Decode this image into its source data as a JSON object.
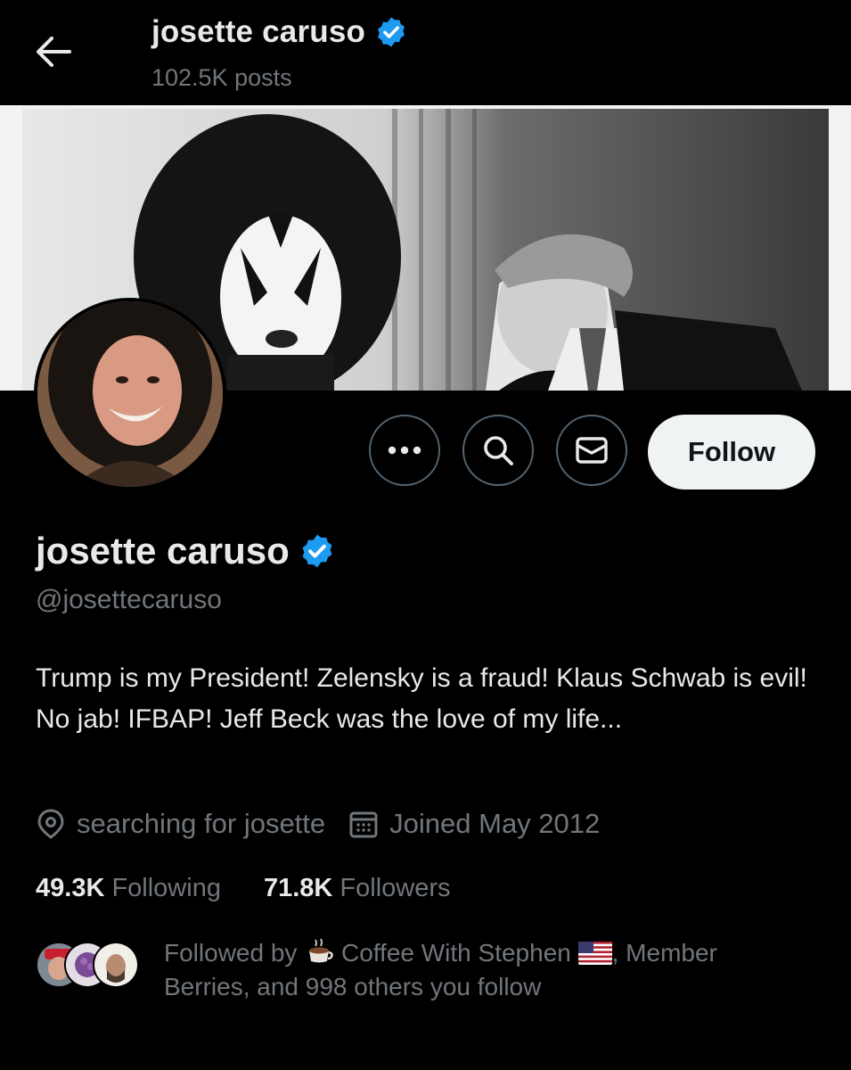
{
  "header": {
    "title": "josette caruso",
    "posts": "102.5K posts"
  },
  "profile": {
    "display_name": "josette caruso",
    "handle": "@josettecaruso",
    "bio": "Trump is my President! Zelensky is a fraud! Klaus Schwab is evil! No jab! IFBAP! Jeff Beck was the love of my life...",
    "location": "searching for josette",
    "joined": "Joined May 2012",
    "following_count": "49.3K",
    "following_label": "Following",
    "followers_count": "71.8K",
    "followers_label": "Followers"
  },
  "actions": {
    "follow_label": "Follow",
    "more_icon": "more-icon",
    "search_icon": "search-icon",
    "message_icon": "message-icon"
  },
  "followed_by": {
    "prefix": "Followed by",
    "name1": "Coffee With Stephen",
    "name1_suffix": ", Member",
    "rest": "Berries, and 998 others you follow"
  },
  "colors": {
    "background": "#000000",
    "text_primary": "#e7e9ea",
    "text_secondary": "#71767b",
    "verified": "#1d9bf0",
    "button_light": "#eff3f4"
  }
}
